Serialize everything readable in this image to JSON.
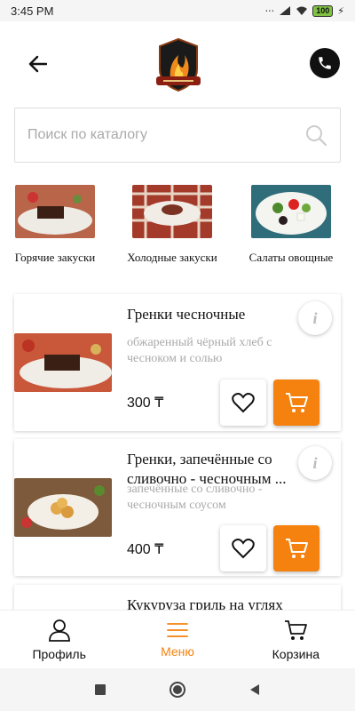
{
  "status_bar": {
    "time": "3:45 PM",
    "battery": "100"
  },
  "search": {
    "placeholder": "Поиск по каталогу"
  },
  "categories": [
    {
      "label": "Горячие закуски"
    },
    {
      "label": "Холодные закуски"
    },
    {
      "label": "Салаты овощные"
    }
  ],
  "products": [
    {
      "title": "Гренки чесночные",
      "description": "обжаренный чёрный хлеб с чесноком и солью",
      "price": "300 ₸"
    },
    {
      "title": "Гренки, запечённые со сливочно - чесночным ...",
      "description": "запечённые со сливочно - чесночным соусом",
      "price": "400 ₸"
    },
    {
      "title": "Кукуруза гриль на углях"
    }
  ],
  "bottom_nav": {
    "items": [
      {
        "label": "Профиль",
        "icon": "user-icon"
      },
      {
        "label": "Меню",
        "icon": "menu-icon",
        "active": true
      },
      {
        "label": "Корзина",
        "icon": "cart-icon"
      }
    ]
  },
  "colors": {
    "accent": "#f5820f",
    "icon_dark": "#111111"
  }
}
